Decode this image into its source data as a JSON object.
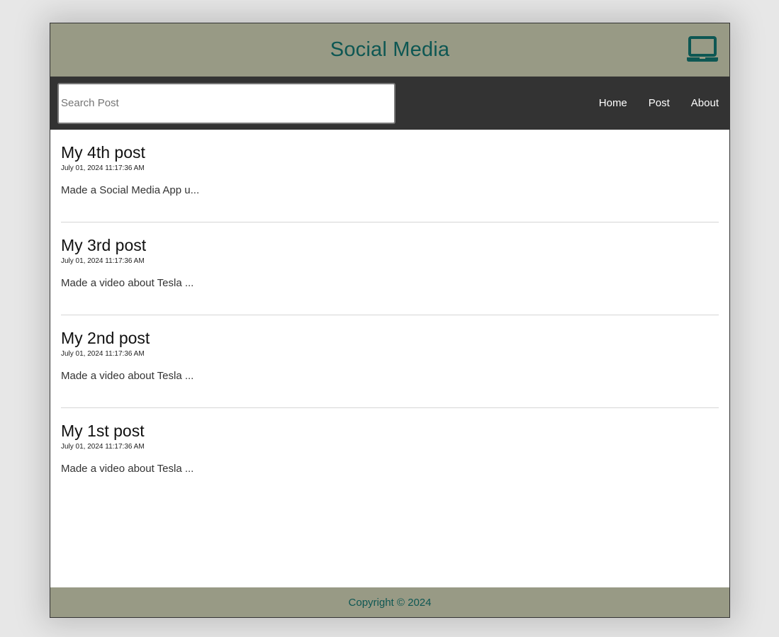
{
  "header": {
    "title": "Social Media",
    "icon": "laptop-icon",
    "title_color": "#0e5753",
    "background": "#989a85"
  },
  "nav": {
    "search": {
      "placeholder": "Search Post",
      "value": ""
    },
    "links": [
      {
        "label": "Home"
      },
      {
        "label": "Post"
      },
      {
        "label": "About"
      }
    ],
    "background": "#333333"
  },
  "feed": {
    "posts": [
      {
        "title": "My 4th post",
        "datetime": "July 01, 2024 11:17:36 AM",
        "snippet": "Made a Social Media App u..."
      },
      {
        "title": "My 3rd post",
        "datetime": "July 01, 2024 11:17:36 AM",
        "snippet": "Made a video about Tesla ..."
      },
      {
        "title": "My 2nd post",
        "datetime": "July 01, 2024 11:17:36 AM",
        "snippet": "Made a video about Tesla ..."
      },
      {
        "title": "My 1st post",
        "datetime": "July 01, 2024 11:17:36 AM",
        "snippet": "Made a video about Tesla ..."
      }
    ]
  },
  "footer": {
    "copyright": "Copyright © 2024"
  }
}
